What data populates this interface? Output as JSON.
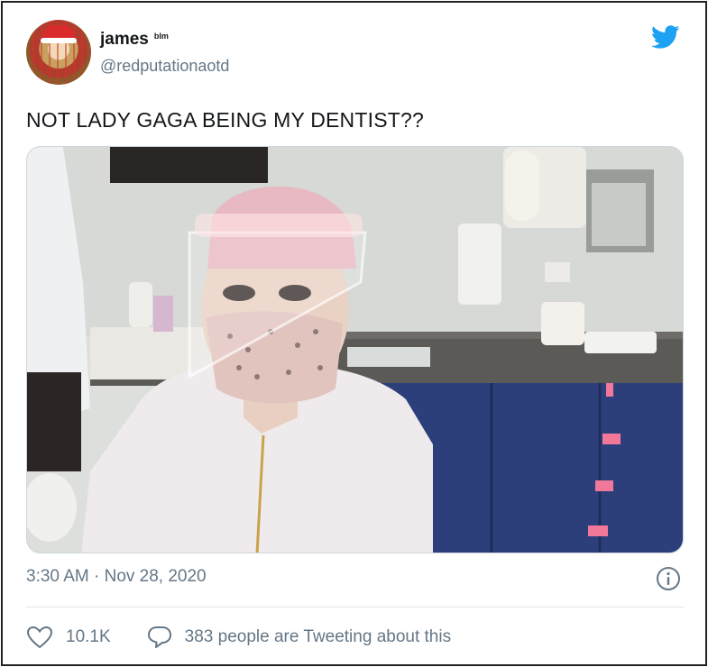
{
  "tweet": {
    "author": {
      "display_name": "james",
      "name_badge": "blm",
      "handle": "@redputationaotd"
    },
    "text": "NOT LADY GAGA BEING MY DENTIST??",
    "timestamp": "3:30 AM · Nov 28, 2020",
    "likes": "10.1K",
    "tweeting_text": "383 people are Tweeting about this"
  },
  "icons": {
    "brand": "twitter-bird-icon",
    "info": "info-icon",
    "like": "heart-icon",
    "reply": "speech-bubble-icon"
  },
  "colors": {
    "twitter_blue": "#1da1f2",
    "secondary_text": "#657786",
    "primary_text": "#14171a"
  }
}
